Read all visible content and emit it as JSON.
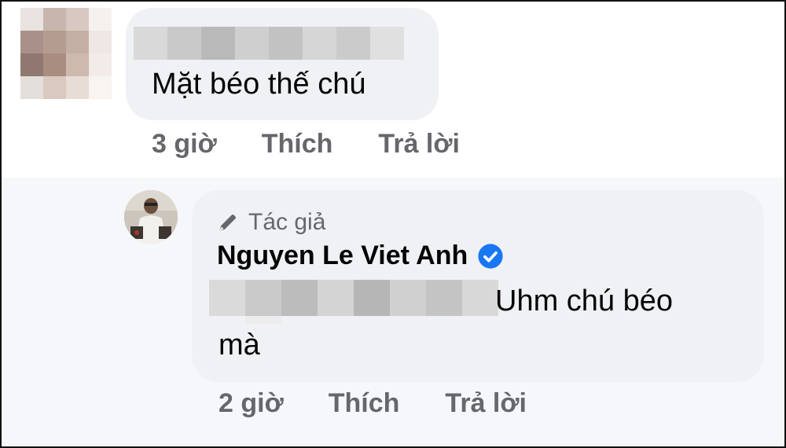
{
  "comment": {
    "text": "Mặt béo thế chú",
    "time": "3 giờ",
    "like_label": "Thích",
    "reply_label": "Trả lời"
  },
  "reply": {
    "author_badge": "Tác giả",
    "author_name": "Nguyen Le Viet Anh",
    "text_line1": "Uhm chú béo",
    "text_line2": "mà",
    "time": "2 giờ",
    "like_label": "Thích",
    "reply_label": "Trả lời"
  },
  "icons": {
    "author_badge_icon": "pen-icon",
    "verified_icon": "verified-check-icon"
  },
  "colors": {
    "bubble": "#eff1f4",
    "verified": "#1877f2",
    "secondary_text": "#65676b"
  }
}
